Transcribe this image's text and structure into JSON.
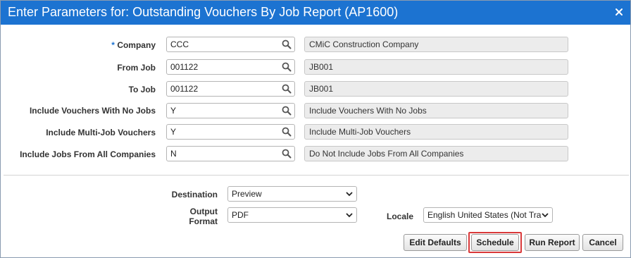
{
  "dialog": {
    "title": "Enter Parameters for: Outstanding Vouchers By Job Report (AP1600)",
    "close_icon": "close-icon",
    "colors": {
      "titlebar": "#1c73d1",
      "highlight": "#d9393a"
    }
  },
  "params": [
    {
      "required": true,
      "required_mark": "*",
      "label": "Company",
      "value": "CCC",
      "description": "CMiC Construction Company"
    },
    {
      "required": false,
      "required_mark": "",
      "label": "From Job",
      "value": "001122",
      "description": "JB001"
    },
    {
      "required": false,
      "required_mark": "",
      "label": "To Job",
      "value": "001122",
      "description": "JB001"
    },
    {
      "required": false,
      "required_mark": "",
      "label": "Include Vouchers With No Jobs",
      "value": "Y",
      "description": "Include Vouchers With No Jobs"
    },
    {
      "required": false,
      "required_mark": "",
      "label": "Include Multi-Job Vouchers",
      "value": "Y",
      "description": "Include Multi-Job Vouchers"
    },
    {
      "required": false,
      "required_mark": "",
      "label": "Include Jobs From All Companies",
      "value": "N",
      "description": "Do Not Include Jobs From All Companies"
    }
  ],
  "output": {
    "destination_label": "Destination",
    "destination_value": "Preview",
    "format_label_line1": "Output",
    "format_label_line2": "Format",
    "format_value": "PDF",
    "locale_label": "Locale",
    "locale_value": "English United States (Not Tra"
  },
  "buttons": {
    "edit_defaults": "Edit Defaults",
    "schedule": "Schedule",
    "run_report": "Run Report",
    "cancel": "Cancel"
  }
}
